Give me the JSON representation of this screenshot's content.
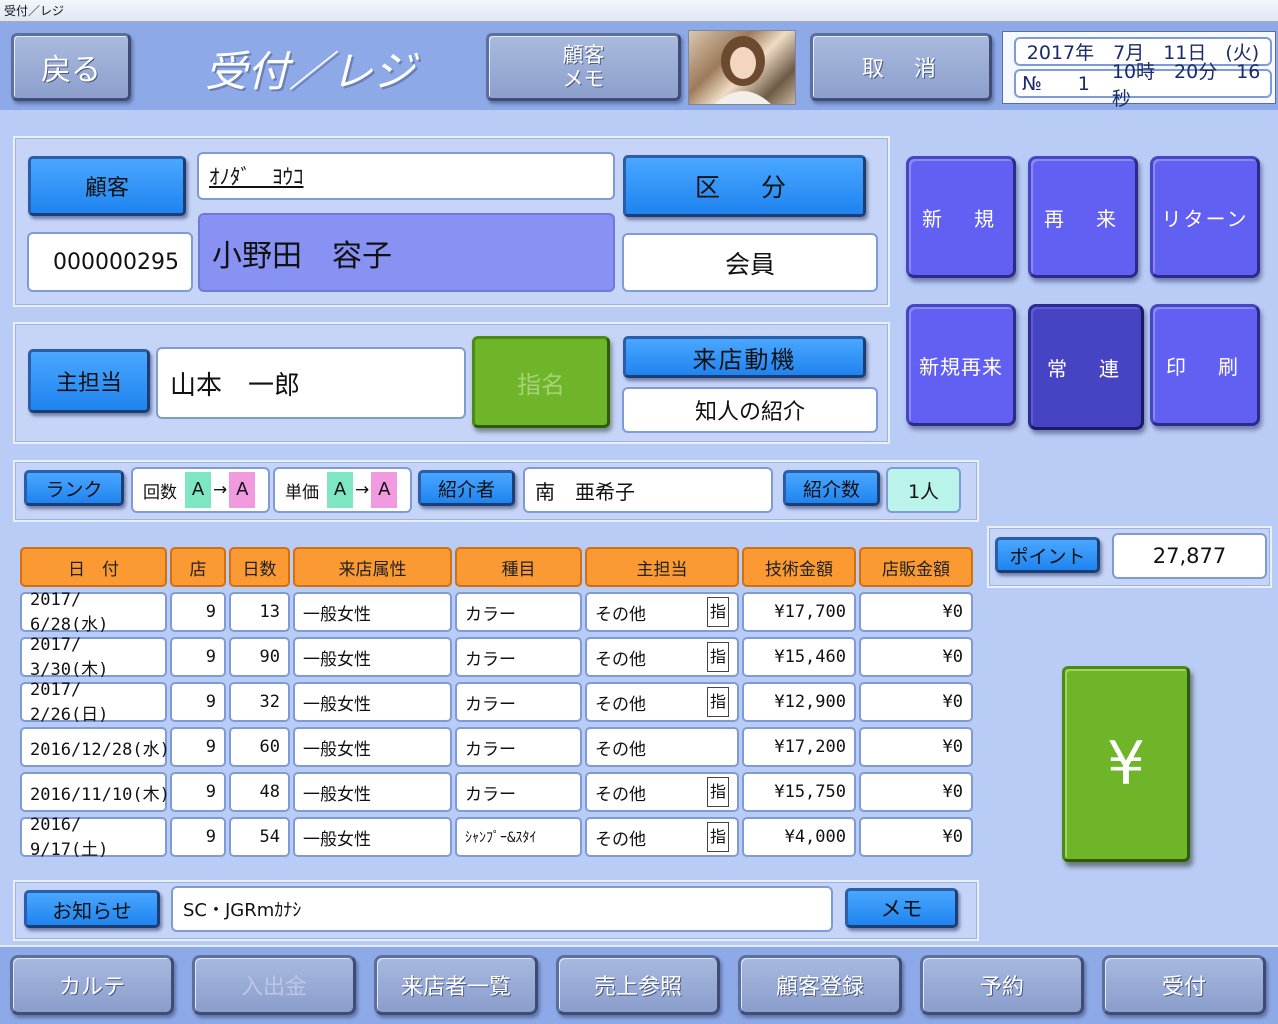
{
  "window": {
    "title": "受付／レジ"
  },
  "header": {
    "back_label": "戻る",
    "screen_title": "受付／レジ",
    "customer_memo_line1": "顧客",
    "customer_memo_line2": "メモ",
    "cancel_label": "取　消",
    "date": "2017年　7月　11日　(火)",
    "no_label": "№",
    "no_value": "1",
    "time": "10時　20分　16秒"
  },
  "customer": {
    "button_label": "顧客",
    "kana": "ｵﾉﾀﾞ　ﾖｳｺ",
    "name": "小野田　容子",
    "id": "000000295",
    "category_button": "区　分",
    "category_value": "会員"
  },
  "visit_types": [
    "新　規",
    "再　来",
    "リターン",
    "新規再来",
    "常　連",
    "印　刷"
  ],
  "staff": {
    "main_label": "主担当",
    "main_value": "山本　一郎",
    "nominate_label": "指名",
    "motive_label": "来店動機",
    "motive_value": "知人の紹介"
  },
  "rank_bar": {
    "rank_label": "ランク",
    "count_label": "回数",
    "count_from": "A",
    "count_to": "A",
    "arrow": "→",
    "price_label": "単価",
    "price_from": "A",
    "price_to": "A",
    "referrer_label": "紹介者",
    "referrer_value": "南　亜希子",
    "referral_count_label": "紹介数",
    "referral_count_value": "1人"
  },
  "points": {
    "label": "ポイント",
    "value": "27,877"
  },
  "history": {
    "headers": [
      "日　付",
      "店",
      "日数",
      "来店属性",
      "種目",
      "主担当",
      "技術金額",
      "店販金額"
    ],
    "rows": [
      {
        "date": "2017/ 6/28(水)",
        "store": "9",
        "days": "13",
        "attribute": "一般女性",
        "type": "カラー",
        "staff": "その他",
        "nominated": "指",
        "tech": "¥17,700",
        "retail": "¥0"
      },
      {
        "date": "2017/ 3/30(木)",
        "store": "9",
        "days": "90",
        "attribute": "一般女性",
        "type": "カラー",
        "staff": "その他",
        "nominated": "指",
        "tech": "¥15,460",
        "retail": "¥0"
      },
      {
        "date": "2017/ 2/26(日)",
        "store": "9",
        "days": "32",
        "attribute": "一般女性",
        "type": "カラー",
        "staff": "その他",
        "nominated": "指",
        "tech": "¥12,900",
        "retail": "¥0"
      },
      {
        "date": "2016/12/28(水)",
        "store": "9",
        "days": "60",
        "attribute": "一般女性",
        "type": "カラー",
        "staff": "その他",
        "nominated": "",
        "tech": "¥17,200",
        "retail": "¥0"
      },
      {
        "date": "2016/11/10(木)",
        "store": "9",
        "days": "48",
        "attribute": "一般女性",
        "type": "カラー",
        "staff": "その他",
        "nominated": "指",
        "tech": "¥15,750",
        "retail": "¥0"
      },
      {
        "date": "2016/ 9/17(土)",
        "store": "9",
        "days": "54",
        "attribute": "一般女性",
        "type": "ｼｬﾝﾌﾟｰ&ｽﾀｲ",
        "staff": "その他",
        "nominated": "指",
        "tech": "¥4,000",
        "retail": "¥0"
      }
    ]
  },
  "notice": {
    "label": "お知らせ",
    "value": "SC・JGRmｶﾅｼ",
    "memo_label": "メモ"
  },
  "pay_button": "¥",
  "footer": [
    "カルテ",
    "入出金",
    "来店者一覧",
    "売上参照",
    "顧客登録",
    "予約",
    "受付"
  ],
  "colors": {
    "header_bg": "#8ea9e8",
    "visit_button": "#6260f3",
    "table_header": "#fb9a32",
    "pay_button": "#6fb52a"
  }
}
